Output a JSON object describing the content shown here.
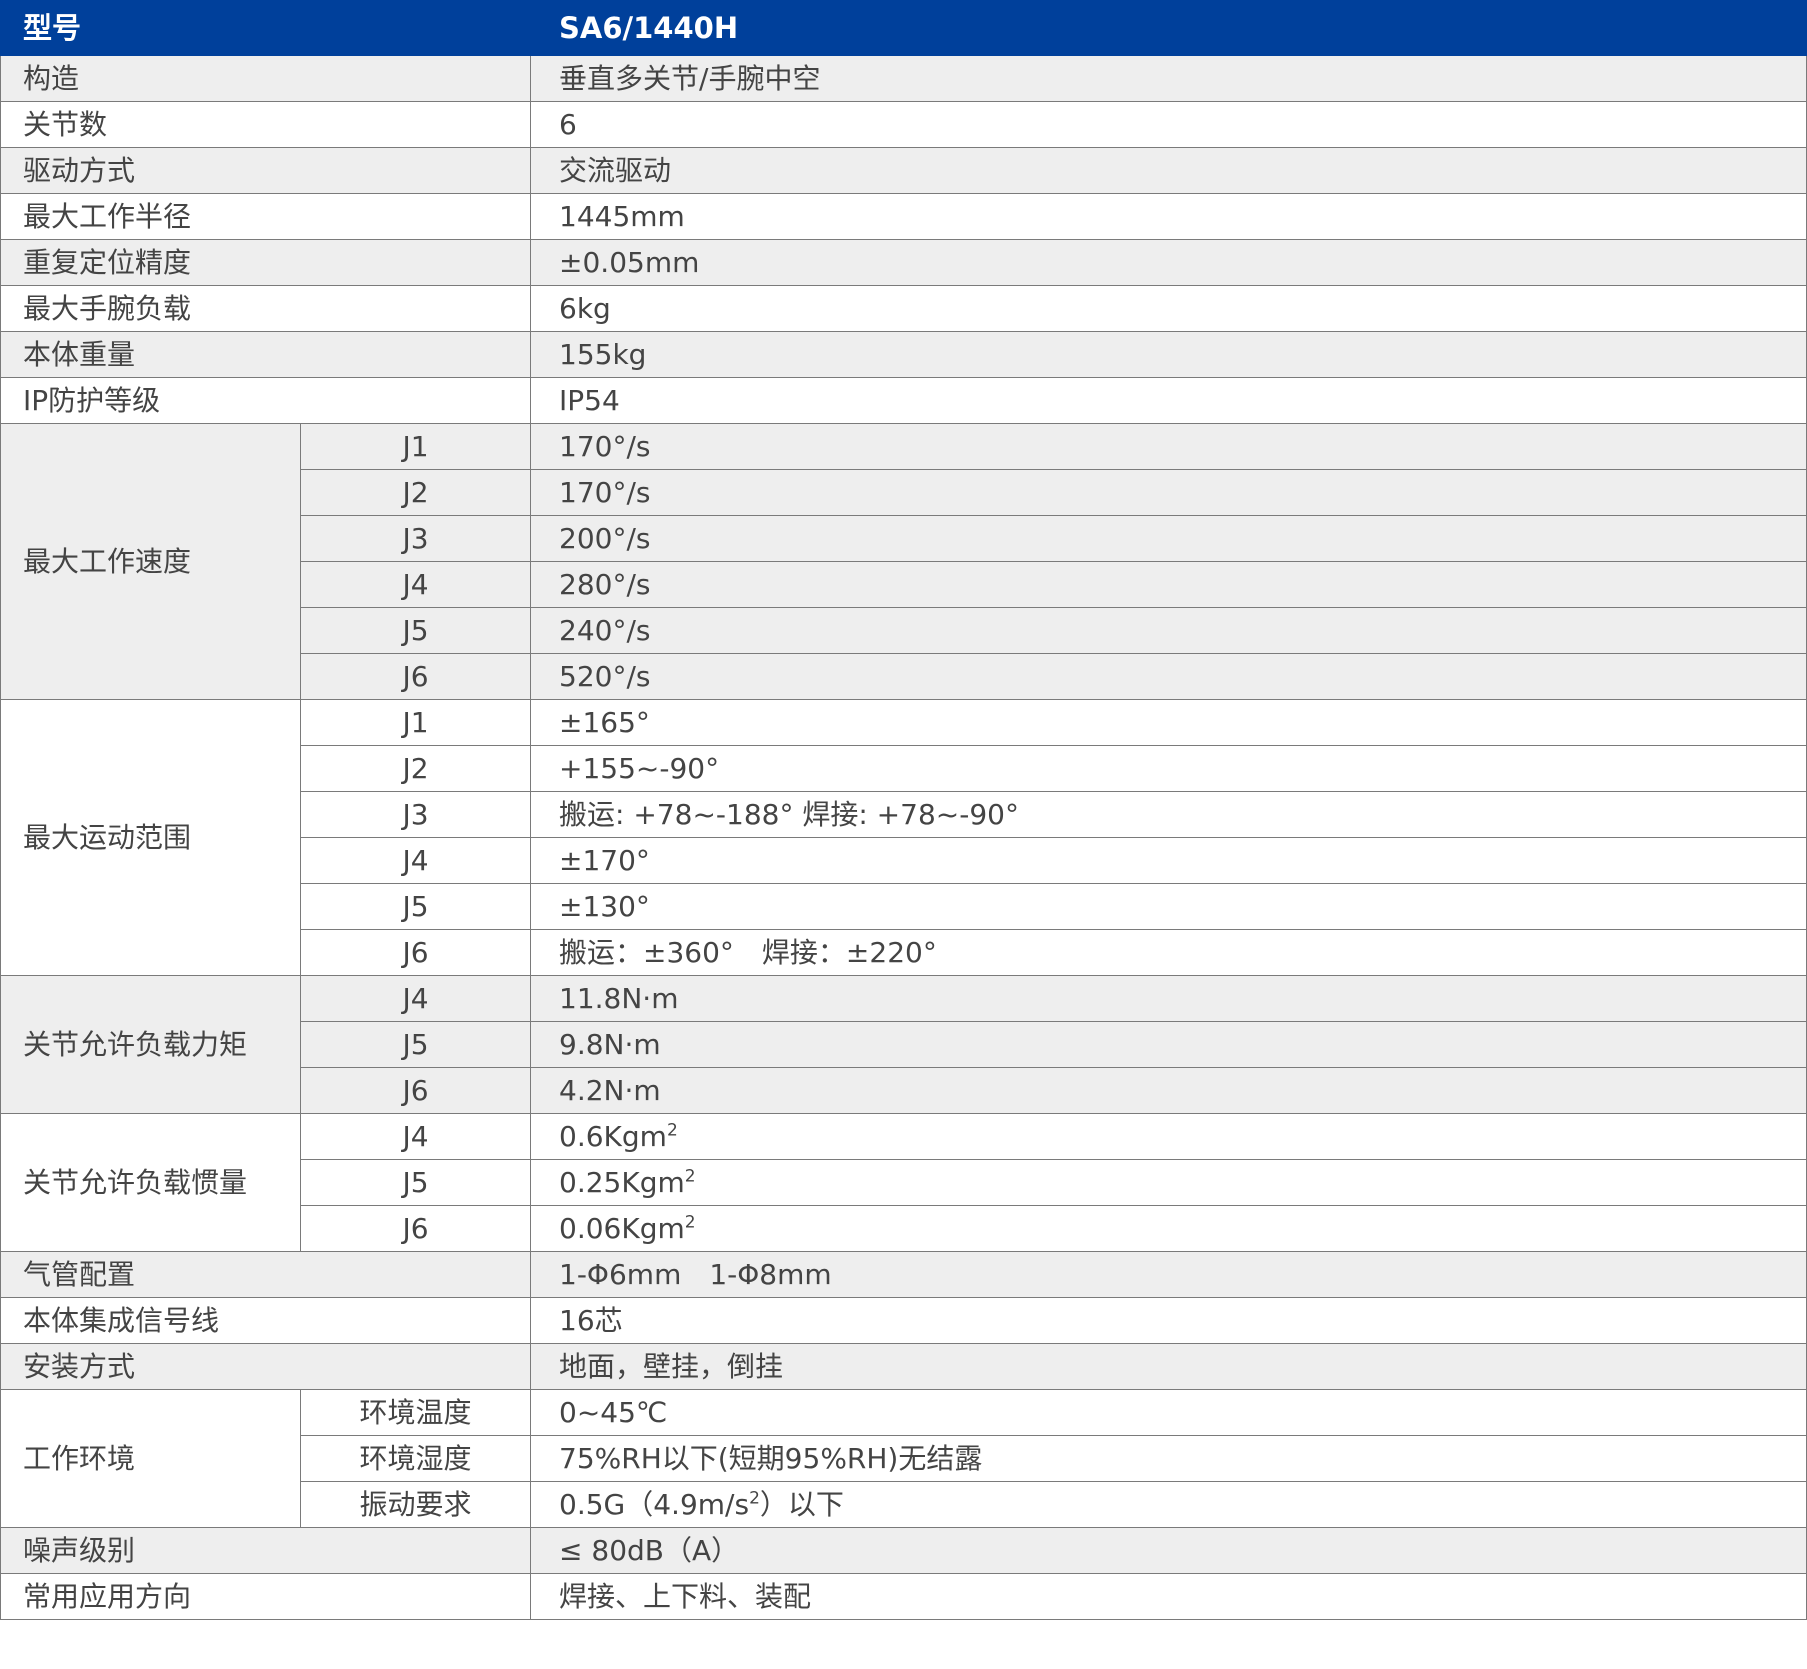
{
  "header": {
    "label": "型号",
    "model": "SA6/1440H"
  },
  "rows": [
    {
      "label": "构造",
      "value": "垂直多关节/手腕中空"
    },
    {
      "label": "关节数",
      "value": "6"
    },
    {
      "label": "驱动方式",
      "value": "交流驱动"
    },
    {
      "label": "最大工作半径",
      "value": "1445mm"
    },
    {
      "label": "重复定位精度",
      "value": "±0.05mm"
    },
    {
      "label": "最大手腕负载",
      "value": "6kg"
    },
    {
      "label": "本体重量",
      "value": "155kg"
    },
    {
      "label": "IP防护等级",
      "value": "IP54"
    }
  ],
  "speed": {
    "label": "最大工作速度",
    "items": [
      {
        "axis": "J1",
        "value": "170°/s"
      },
      {
        "axis": "J2",
        "value": "170°/s"
      },
      {
        "axis": "J3",
        "value": "200°/s"
      },
      {
        "axis": "J4",
        "value": "280°/s"
      },
      {
        "axis": "J5",
        "value": "240°/s"
      },
      {
        "axis": "J6",
        "value": "520°/s"
      }
    ]
  },
  "range": {
    "label": "最大运动范围",
    "items": [
      {
        "axis": "J1",
        "value": "±165°"
      },
      {
        "axis": "J2",
        "value": "+155~-90°"
      },
      {
        "axis": "J3",
        "value": "搬运: +78~-188° 焊接: +78~-90°"
      },
      {
        "axis": "J4",
        "value": "±170°"
      },
      {
        "axis": "J5",
        "value": "±130°"
      },
      {
        "axis": "J6",
        "value": "搬运：±360°　焊接：±220°"
      }
    ]
  },
  "torque": {
    "label": "关节允许负载力矩",
    "items": [
      {
        "axis": "J4",
        "value": "11.8N·m"
      },
      {
        "axis": "J5",
        "value": "9.8N·m"
      },
      {
        "axis": "J6",
        "value": "4.2N·m"
      }
    ]
  },
  "inertia": {
    "label": "关节允许负载惯量",
    "unit_base": "Kgm",
    "unit_sup": "2",
    "items": [
      {
        "axis": "J4",
        "value": "0.6"
      },
      {
        "axis": "J5",
        "value": "0.25"
      },
      {
        "axis": "J6",
        "value": "0.06"
      }
    ]
  },
  "rows2": [
    {
      "label": "气管配置",
      "value": "1-Φ6mm　1-Φ8mm"
    },
    {
      "label": "本体集成信号线",
      "value": "16芯"
    },
    {
      "label": "安装方式",
      "value": "地面，壁挂，倒挂"
    }
  ],
  "env": {
    "label": "工作环境",
    "items": [
      {
        "name": "环境温度",
        "value": "0~45℃"
      },
      {
        "name": "环境湿度",
        "value": "75%RH以下(短期95%RH)无结露"
      },
      {
        "name": "振动要求",
        "value_pre": "0.5G（4.9m/s",
        "value_sup": "2",
        "value_post": "）以下"
      }
    ]
  },
  "rows3": [
    {
      "label": "噪声级别",
      "value": "≤ 80dB（A）"
    },
    {
      "label": "常用应用方向",
      "value": "焊接、上下料、装配"
    }
  ]
}
